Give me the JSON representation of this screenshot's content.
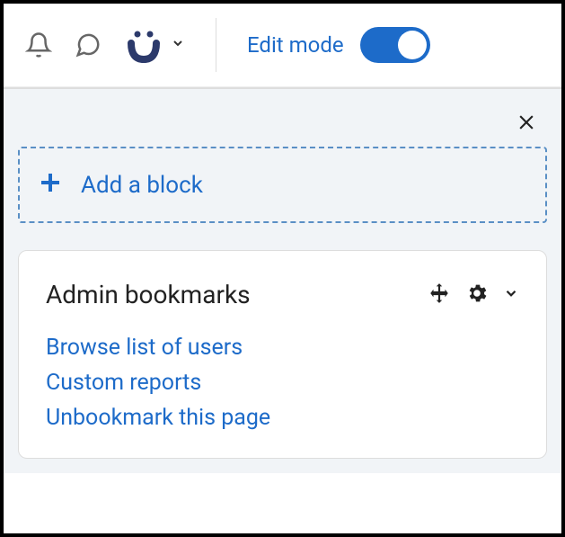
{
  "topbar": {
    "edit_mode_label": "Edit mode",
    "edit_mode_on": true
  },
  "drawer": {
    "add_block_label": "Add a block"
  },
  "block": {
    "title": "Admin bookmarks",
    "links": {
      "browse_users": "Browse list of users",
      "custom_reports": "Custom reports",
      "unbookmark": "Unbookmark this page"
    }
  },
  "colors": {
    "link": "#1d6bc9",
    "accent": "#1d6bc9"
  }
}
